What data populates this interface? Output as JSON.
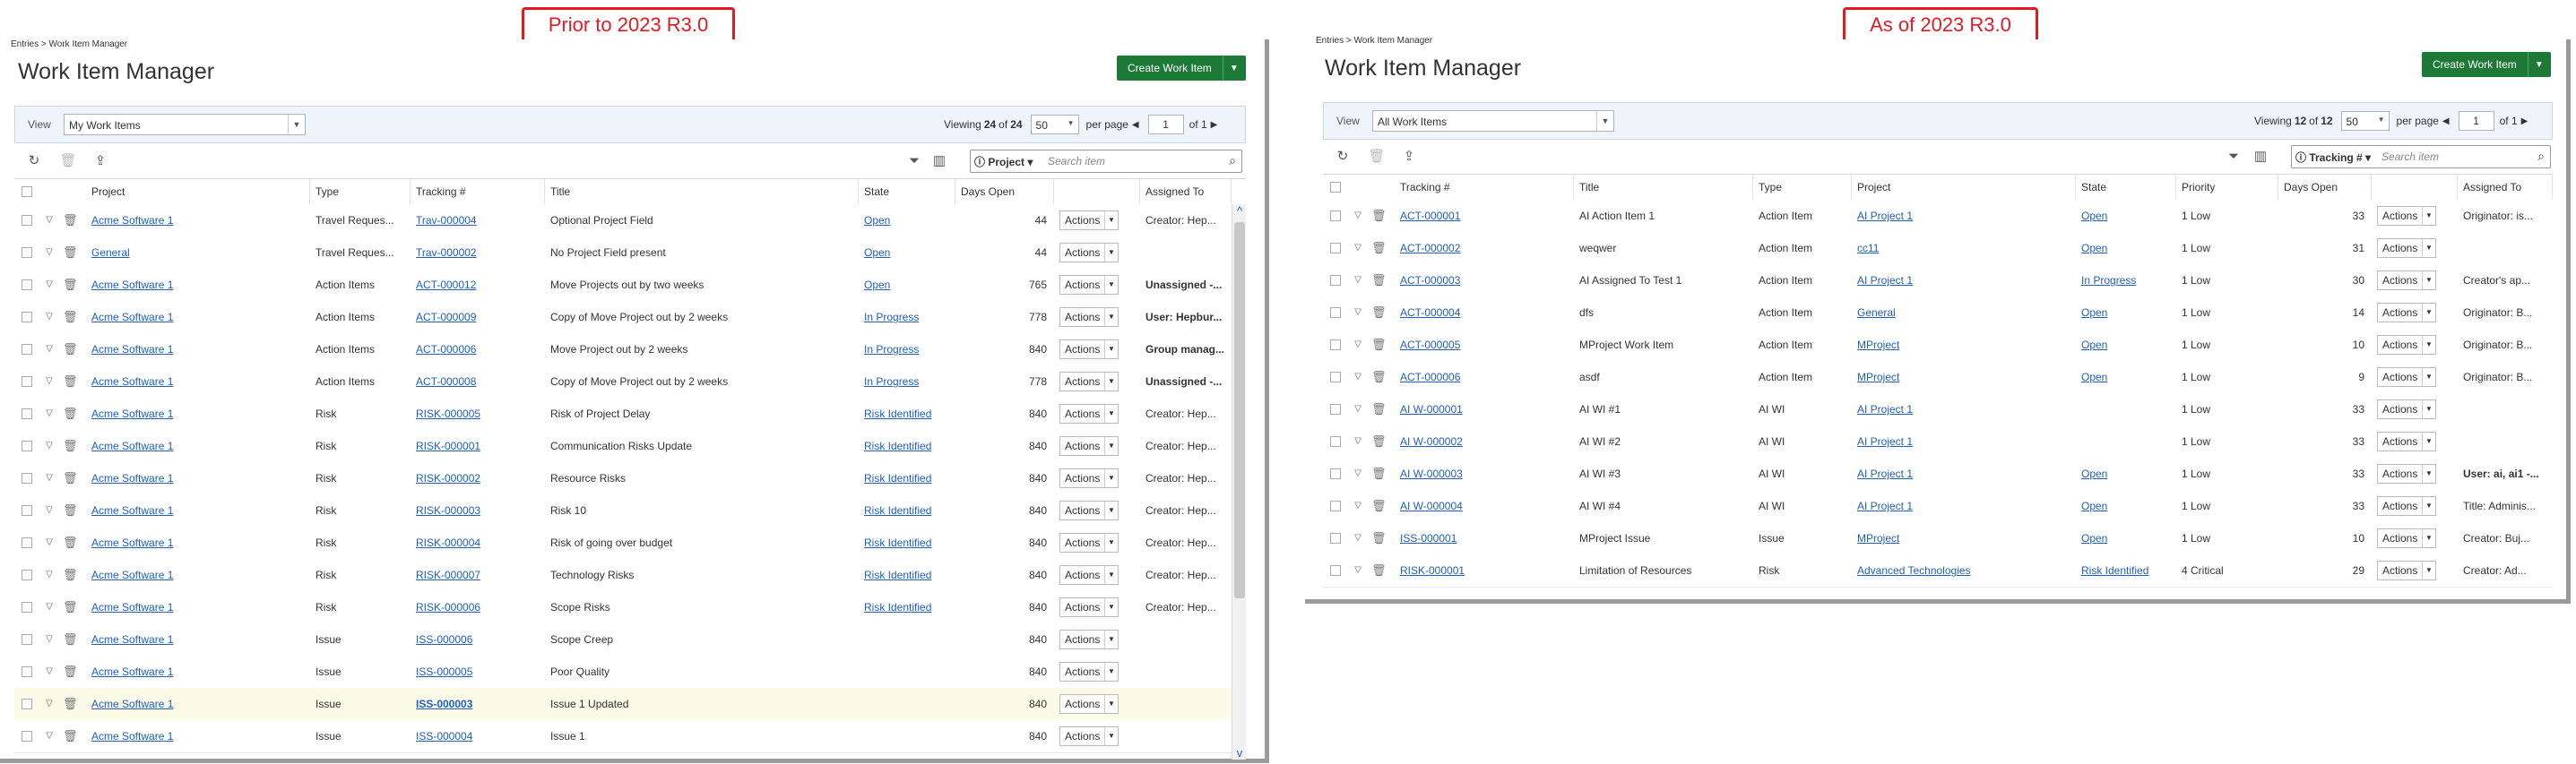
{
  "callouts": {
    "left": "Prior to 2023 R3.0",
    "right": "As of 2023 R3.0"
  },
  "left": {
    "breadcrumb": "Entries > Work Item Manager",
    "title": "Work Item Manager",
    "create_label": "Create Work Item",
    "view_label": "View",
    "view_value": "My Work Items",
    "viewing_label": "Viewing",
    "viewing_count": "24",
    "of_label": "of",
    "viewing_total": "24",
    "per_page_value": "50",
    "per_page_label": "per page",
    "page_value": "1",
    "page_of": "of 1",
    "search_filter": "Project",
    "search_placeholder": "Search item",
    "columns": [
      "Project",
      "Type",
      "Tracking #",
      "Title",
      "State",
      "Days Open",
      "Assigned To"
    ],
    "action_label": "Actions",
    "rows": [
      {
        "project": "Acme Software 1",
        "type": "Travel Reques...",
        "tracking": "Trav-000004",
        "title": "Optional Project Field",
        "state": "Open",
        "days": "44",
        "assigned": "Creator: Hep..."
      },
      {
        "project": "General",
        "type": "Travel Reques...",
        "tracking": "Trav-000002",
        "title": "No Project Field present",
        "state": "Open",
        "days": "44",
        "assigned": ""
      },
      {
        "project": "Acme Software 1",
        "type": "Action Items",
        "tracking": "ACT-000012",
        "title": "Move Projects out by two weeks",
        "state": "Open",
        "days": "765",
        "assigned": "Unassigned -..."
      },
      {
        "project": "Acme Software 1",
        "type": "Action Items",
        "tracking": "ACT-000009",
        "title": "Copy of Move Project out by 2 weeks",
        "state": "In Progress",
        "days": "778",
        "assigned": "User: Hepbur..."
      },
      {
        "project": "Acme Software 1",
        "type": "Action Items",
        "tracking": "ACT-000006",
        "title": "Move Project out by 2 weeks",
        "state": "In Progress",
        "days": "840",
        "assigned": "Group manag..."
      },
      {
        "project": "Acme Software 1",
        "type": "Action Items",
        "tracking": "ACT-000008",
        "title": "Copy of Move Project out by 2 weeks",
        "state": "In Progress",
        "days": "778",
        "assigned": "Unassigned -..."
      },
      {
        "project": "Acme Software 1",
        "type": "Risk",
        "tracking": "RISK-000005",
        "title": "Risk of Project Delay",
        "state": "Risk Identified",
        "days": "840",
        "assigned": "Creator: Hep..."
      },
      {
        "project": "Acme Software 1",
        "type": "Risk",
        "tracking": "RISK-000001",
        "title": "Communication Risks Update",
        "state": "Risk Identified",
        "days": "840",
        "assigned": "Creator: Hep..."
      },
      {
        "project": "Acme Software 1",
        "type": "Risk",
        "tracking": "RISK-000002",
        "title": "Resource Risks",
        "state": "Risk Identified",
        "days": "840",
        "assigned": "Creator: Hep..."
      },
      {
        "project": "Acme Software 1",
        "type": "Risk",
        "tracking": "RISK-000003",
        "title": "Risk 10",
        "state": "Risk Identified",
        "days": "840",
        "assigned": "Creator: Hep..."
      },
      {
        "project": "Acme Software 1",
        "type": "Risk",
        "tracking": "RISK-000004",
        "title": "Risk of going over budget",
        "state": "Risk Identified",
        "days": "840",
        "assigned": "Creator: Hep..."
      },
      {
        "project": "Acme Software 1",
        "type": "Risk",
        "tracking": "RISK-000007",
        "title": "Technology Risks",
        "state": "Risk Identified",
        "days": "840",
        "assigned": "Creator: Hep..."
      },
      {
        "project": "Acme Software 1",
        "type": "Risk",
        "tracking": "RISK-000006",
        "title": "Scope Risks",
        "state": "Risk Identified",
        "days": "840",
        "assigned": "Creator: Hep..."
      },
      {
        "project": "Acme Software 1",
        "type": "Issue",
        "tracking": "ISS-000006",
        "title": "Scope Creep",
        "state": "",
        "days": "840",
        "assigned": ""
      },
      {
        "project": "Acme Software 1",
        "type": "Issue",
        "tracking": "ISS-000005",
        "title": "Poor Quality",
        "state": "",
        "days": "840",
        "assigned": ""
      },
      {
        "project": "Acme Software 1",
        "type": "Issue",
        "tracking": "ISS-000003",
        "title": "Issue 1 Updated",
        "state": "",
        "days": "840",
        "assigned": ""
      },
      {
        "project": "Acme Software 1",
        "type": "Issue",
        "tracking": "ISS-000004",
        "title": "Issue 1",
        "state": "",
        "days": "840",
        "assigned": ""
      }
    ]
  },
  "right": {
    "breadcrumb": "Entries > Work Item Manager",
    "title": "Work Item Manager",
    "create_label": "Create Work Item",
    "view_label": "View",
    "view_value": "All Work Items",
    "viewing_label": "Viewing",
    "viewing_count": "12",
    "of_label": "of",
    "viewing_total": "12",
    "per_page_value": "50",
    "per_page_label": "per page",
    "page_value": "1",
    "page_of": "of 1",
    "search_filter": "Tracking #",
    "search_placeholder": "Search item",
    "columns": [
      "Tracking #",
      "Title",
      "Type",
      "Project",
      "State",
      "Priority",
      "Days Open",
      "Assigned To"
    ],
    "action_label": "Actions",
    "rows": [
      {
        "tracking": "ACT-000001",
        "title": "AI Action Item 1",
        "type": "Action Item",
        "project": "AI Project 1",
        "state": "Open",
        "priority": "1 Low",
        "days": "33",
        "assigned": "Originator: is..."
      },
      {
        "tracking": "ACT-000002",
        "title": "weqwer",
        "type": "Action Item",
        "project": "cc11",
        "state": "Open",
        "priority": "1 Low",
        "days": "31",
        "assigned": ""
      },
      {
        "tracking": "ACT-000003",
        "title": "AI Assigned To Test 1",
        "type": "Action Item",
        "project": "AI Project 1",
        "state": "In Progress",
        "priority": "1 Low",
        "days": "30",
        "assigned": "Creator's ap..."
      },
      {
        "tracking": "ACT-000004",
        "title": "dfs",
        "type": "Action Item",
        "project": "General",
        "state": "Open",
        "priority": "1 Low",
        "days": "14",
        "assigned": "Originator: B..."
      },
      {
        "tracking": "ACT-000005",
        "title": "MProject Work Item",
        "type": "Action Item",
        "project": "MProject",
        "state": "Open",
        "priority": "1 Low",
        "days": "10",
        "assigned": "Originator: B..."
      },
      {
        "tracking": "ACT-000006",
        "title": "asdf",
        "type": "Action Item",
        "project": "MProject",
        "state": "Open",
        "priority": "1 Low",
        "days": "9",
        "assigned": "Originator: B..."
      },
      {
        "tracking": "AI W-000001",
        "title": "AI WI #1",
        "type": "AI WI",
        "project": "AI Project 1",
        "state": "",
        "priority": "1 Low",
        "days": "33",
        "assigned": ""
      },
      {
        "tracking": "AI W-000002",
        "title": "AI WI #2",
        "type": "AI WI",
        "project": "AI Project 1",
        "state": "",
        "priority": "1 Low",
        "days": "33",
        "assigned": ""
      },
      {
        "tracking": "AI W-000003",
        "title": "AI WI #3",
        "type": "AI WI",
        "project": "AI Project 1",
        "state": "Open",
        "priority": "1 Low",
        "days": "33",
        "assigned": "User: ai, ai1 -..."
      },
      {
        "tracking": "AI W-000004",
        "title": "AI WI #4",
        "type": "AI WI",
        "project": "AI Project 1",
        "state": "Open",
        "priority": "1 Low",
        "days": "33",
        "assigned": "Title: Adminis..."
      },
      {
        "tracking": "ISS-000001",
        "title": "MProject Issue",
        "type": "Issue",
        "project": "MProject",
        "state": "Open",
        "priority": "1 Low",
        "days": "10",
        "assigned": "Creator: Buj..."
      },
      {
        "tracking": "RISK-000001",
        "title": "Limitation of Resources",
        "type": "Risk",
        "project": "Advanced Technologies",
        "state": "Risk Identified",
        "priority": "4 Critical",
        "days": "29",
        "assigned": "Creator: Ad..."
      }
    ]
  }
}
